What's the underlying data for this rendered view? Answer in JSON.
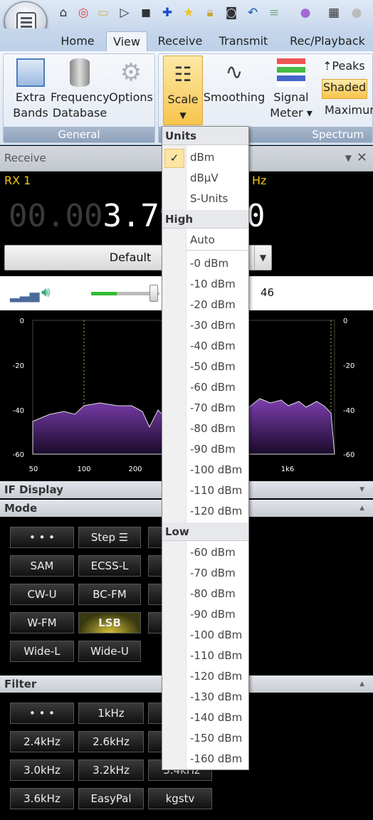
{
  "tabs": [
    "Home",
    "View",
    "Receive",
    "Transmit",
    "Rec/Playback"
  ],
  "active_tab": "View",
  "ribbon": {
    "general": {
      "label": "General",
      "buttons": [
        "Extra Bands",
        "Frequency Database",
        "Options"
      ],
      "extra_l1": "Extra",
      "extra_l2": "Bands",
      "freq_l1": "Frequency",
      "freq_l2": "Database",
      "options": "Options"
    },
    "spectrum": {
      "label": "Spectrum",
      "scale": "Scale",
      "smoothing": "Smoothing",
      "signal_l1": "Signal",
      "signal_l2": "Meter",
      "peaks": "Peaks",
      "shaded": "Shaded",
      "maximum": "Maximum"
    }
  },
  "receive": {
    "title": "Receive",
    "rx": "RX 1",
    "unit": "Hz",
    "freq_dim": "00.00",
    "freq_bright": "3.79",
    "freq_tail": "0",
    "preset": "Default",
    "volume_value": "46"
  },
  "spectrum_axis": {
    "left": [
      "0",
      "-20",
      "-40",
      "-60"
    ],
    "right": [
      "0",
      "-20",
      "-40",
      "-60"
    ],
    "bottom": [
      "50",
      "100",
      "200",
      "1k6"
    ]
  },
  "sections": {
    "if_display": "IF Display",
    "mode": "Mode",
    "filter": "Filter"
  },
  "mode_buttons": [
    [
      "• • •",
      "Step ☰",
      ""
    ],
    [
      "SAM",
      "ECSS-L",
      ""
    ],
    [
      "CW-U",
      "BC-FM",
      ""
    ],
    [
      "W-FM",
      "LSB",
      ""
    ],
    [
      "Wide-L",
      "Wide-U"
    ]
  ],
  "filter_buttons": [
    [
      "• • •",
      "1kHz",
      ""
    ],
    [
      "2.4kHz",
      "2.6kHz",
      ""
    ],
    [
      "3.0kHz",
      "3.2kHz",
      "3.4kHz"
    ],
    [
      "3.6kHz",
      "EasyPal",
      "kgstv"
    ]
  ],
  "dropdown": {
    "units_header": "Units",
    "units": [
      "dBm",
      "dBµV",
      "S-Units"
    ],
    "selected_unit": "dBm",
    "high_header": "High",
    "high": [
      "Auto",
      "-0 dBm",
      "-10 dBm",
      "-20 dBm",
      "-30 dBm",
      "-40 dBm",
      "-50 dBm",
      "-60 dBm",
      "-70 dBm",
      "-80 dBm",
      "-90 dBm",
      "-100 dBm",
      "-110 dBm",
      "-120 dBm"
    ],
    "low_header": "Low",
    "low": [
      "-60 dBm",
      "-70 dBm",
      "-80 dBm",
      "-90 dBm",
      "-100 dBm",
      "-110 dBm",
      "-120 dBm",
      "-130 dBm",
      "-140 dBm",
      "-150 dBm",
      "-160 dBm"
    ]
  }
}
